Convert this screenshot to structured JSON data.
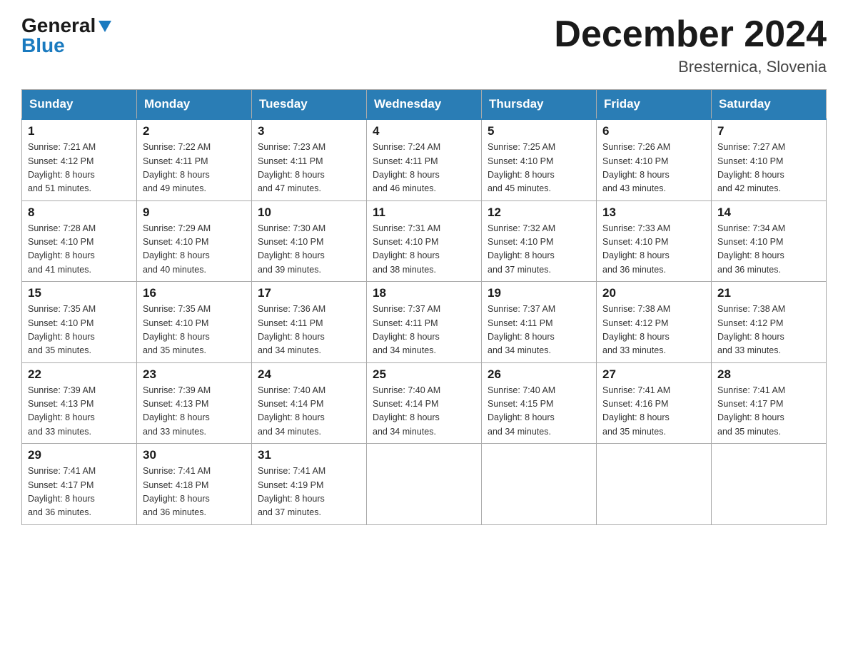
{
  "header": {
    "logo_general": "General",
    "logo_blue": "Blue",
    "month_title": "December 2024",
    "location": "Bresternica, Slovenia"
  },
  "days_of_week": [
    "Sunday",
    "Monday",
    "Tuesday",
    "Wednesday",
    "Thursday",
    "Friday",
    "Saturday"
  ],
  "weeks": [
    [
      {
        "day": "1",
        "sunrise": "7:21 AM",
        "sunset": "4:12 PM",
        "daylight": "8 hours and 51 minutes."
      },
      {
        "day": "2",
        "sunrise": "7:22 AM",
        "sunset": "4:11 PM",
        "daylight": "8 hours and 49 minutes."
      },
      {
        "day": "3",
        "sunrise": "7:23 AM",
        "sunset": "4:11 PM",
        "daylight": "8 hours and 47 minutes."
      },
      {
        "day": "4",
        "sunrise": "7:24 AM",
        "sunset": "4:11 PM",
        "daylight": "8 hours and 46 minutes."
      },
      {
        "day": "5",
        "sunrise": "7:25 AM",
        "sunset": "4:10 PM",
        "daylight": "8 hours and 45 minutes."
      },
      {
        "day": "6",
        "sunrise": "7:26 AM",
        "sunset": "4:10 PM",
        "daylight": "8 hours and 43 minutes."
      },
      {
        "day": "7",
        "sunrise": "7:27 AM",
        "sunset": "4:10 PM",
        "daylight": "8 hours and 42 minutes."
      }
    ],
    [
      {
        "day": "8",
        "sunrise": "7:28 AM",
        "sunset": "4:10 PM",
        "daylight": "8 hours and 41 minutes."
      },
      {
        "day": "9",
        "sunrise": "7:29 AM",
        "sunset": "4:10 PM",
        "daylight": "8 hours and 40 minutes."
      },
      {
        "day": "10",
        "sunrise": "7:30 AM",
        "sunset": "4:10 PM",
        "daylight": "8 hours and 39 minutes."
      },
      {
        "day": "11",
        "sunrise": "7:31 AM",
        "sunset": "4:10 PM",
        "daylight": "8 hours and 38 minutes."
      },
      {
        "day": "12",
        "sunrise": "7:32 AM",
        "sunset": "4:10 PM",
        "daylight": "8 hours and 37 minutes."
      },
      {
        "day": "13",
        "sunrise": "7:33 AM",
        "sunset": "4:10 PM",
        "daylight": "8 hours and 36 minutes."
      },
      {
        "day": "14",
        "sunrise": "7:34 AM",
        "sunset": "4:10 PM",
        "daylight": "8 hours and 36 minutes."
      }
    ],
    [
      {
        "day": "15",
        "sunrise": "7:35 AM",
        "sunset": "4:10 PM",
        "daylight": "8 hours and 35 minutes."
      },
      {
        "day": "16",
        "sunrise": "7:35 AM",
        "sunset": "4:10 PM",
        "daylight": "8 hours and 35 minutes."
      },
      {
        "day": "17",
        "sunrise": "7:36 AM",
        "sunset": "4:11 PM",
        "daylight": "8 hours and 34 minutes."
      },
      {
        "day": "18",
        "sunrise": "7:37 AM",
        "sunset": "4:11 PM",
        "daylight": "8 hours and 34 minutes."
      },
      {
        "day": "19",
        "sunrise": "7:37 AM",
        "sunset": "4:11 PM",
        "daylight": "8 hours and 34 minutes."
      },
      {
        "day": "20",
        "sunrise": "7:38 AM",
        "sunset": "4:12 PM",
        "daylight": "8 hours and 33 minutes."
      },
      {
        "day": "21",
        "sunrise": "7:38 AM",
        "sunset": "4:12 PM",
        "daylight": "8 hours and 33 minutes."
      }
    ],
    [
      {
        "day": "22",
        "sunrise": "7:39 AM",
        "sunset": "4:13 PM",
        "daylight": "8 hours and 33 minutes."
      },
      {
        "day": "23",
        "sunrise": "7:39 AM",
        "sunset": "4:13 PM",
        "daylight": "8 hours and 33 minutes."
      },
      {
        "day": "24",
        "sunrise": "7:40 AM",
        "sunset": "4:14 PM",
        "daylight": "8 hours and 34 minutes."
      },
      {
        "day": "25",
        "sunrise": "7:40 AM",
        "sunset": "4:14 PM",
        "daylight": "8 hours and 34 minutes."
      },
      {
        "day": "26",
        "sunrise": "7:40 AM",
        "sunset": "4:15 PM",
        "daylight": "8 hours and 34 minutes."
      },
      {
        "day": "27",
        "sunrise": "7:41 AM",
        "sunset": "4:16 PM",
        "daylight": "8 hours and 35 minutes."
      },
      {
        "day": "28",
        "sunrise": "7:41 AM",
        "sunset": "4:17 PM",
        "daylight": "8 hours and 35 minutes."
      }
    ],
    [
      {
        "day": "29",
        "sunrise": "7:41 AM",
        "sunset": "4:17 PM",
        "daylight": "8 hours and 36 minutes."
      },
      {
        "day": "30",
        "sunrise": "7:41 AM",
        "sunset": "4:18 PM",
        "daylight": "8 hours and 36 minutes."
      },
      {
        "day": "31",
        "sunrise": "7:41 AM",
        "sunset": "4:19 PM",
        "daylight": "8 hours and 37 minutes."
      },
      null,
      null,
      null,
      null
    ]
  ],
  "labels": {
    "sunrise": "Sunrise:",
    "sunset": "Sunset:",
    "daylight": "Daylight:"
  }
}
